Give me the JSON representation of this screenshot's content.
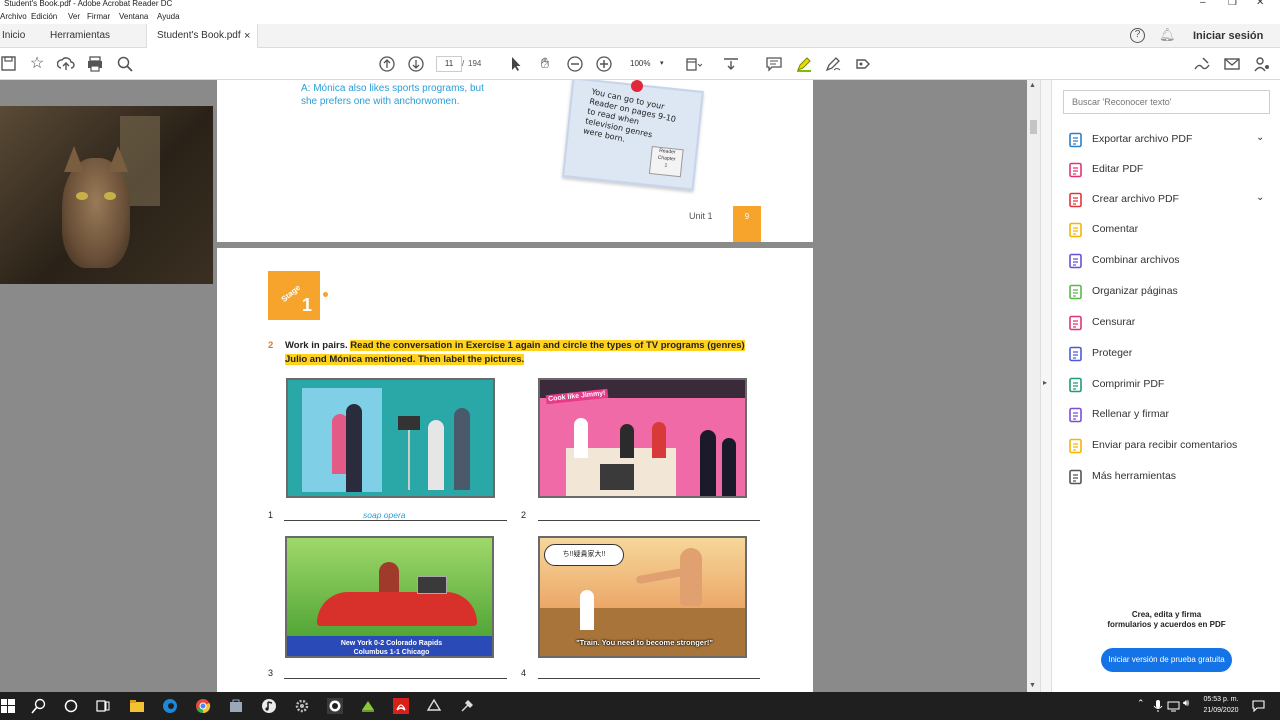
{
  "window": {
    "title": "Student's Book.pdf - Adobe Acrobat Reader DC",
    "menu": [
      "Archivo",
      "Edición",
      "Ver",
      "Firmar",
      "Ventana",
      "Ayuda"
    ]
  },
  "tabs": {
    "home": "Inicio",
    "tools": "Herramientas",
    "document": "Student's Book.pdf",
    "close": "×",
    "signin": "Iniciar sesión"
  },
  "toolbar": {
    "page_current": "11",
    "page_sep": "/",
    "page_total": "194",
    "zoom": "100%"
  },
  "page_top": {
    "answer_line1": "A: Mónica also likes sports programs, but",
    "answer_line2": "she prefers one with anchorwomen.",
    "note_lines": [
      "You can go to your",
      "Reader on pages 9-10",
      "to read when",
      "television genres",
      "were born."
    ],
    "note_booklet": [
      "Reader",
      "Chapter",
      "1"
    ],
    "unit_label": "Unit 1",
    "page_number": "9"
  },
  "page_main": {
    "stage_word": "Stage",
    "stage_number": "1",
    "exercise_number": "2",
    "instruction_bold": "Work in pairs.",
    "instruction_line1": "Read the conversation in Exercise 1 again and circle the types of TV programs (genres)",
    "instruction_line2": "Julio and Mónica mentioned. Then label the pictures.",
    "items": [
      {
        "number": "1",
        "answer": "soap opera"
      },
      {
        "number": "2",
        "answer": ""
      },
      {
        "number": "3",
        "answer": ""
      },
      {
        "number": "4",
        "answer": ""
      }
    ],
    "cooking_sign": "Cook like Jimmy!",
    "news_ticker_line1": "New York 0-2 Colorado Rapids",
    "news_ticker_line2": "Columbus 1-1 Chicago",
    "speech_bubble": "ち!!疑貴家大!!",
    "karate_caption": "\"Train. You need to become stronger!\""
  },
  "right_pane": {
    "search_placeholder": "Buscar 'Reconocer texto'",
    "tools": [
      {
        "label": "Exportar archivo PDF",
        "icon": "export-pdf-icon",
        "color": "#2d7fc9",
        "chevron": "⌄"
      },
      {
        "label": "Editar PDF",
        "icon": "edit-pdf-icon",
        "color": "#e0347a",
        "chevron": ""
      },
      {
        "label": "Crear archivo PDF",
        "icon": "create-pdf-icon",
        "color": "#e0343a",
        "chevron": "⌄"
      },
      {
        "label": "Comentar",
        "icon": "comment-icon",
        "color": "#f2b600",
        "chevron": ""
      },
      {
        "label": "Combinar archivos",
        "icon": "combine-files-icon",
        "color": "#6b4fd8",
        "chevron": ""
      },
      {
        "label": "Organizar páginas",
        "icon": "organize-pages-icon",
        "color": "#5cb84a",
        "chevron": ""
      },
      {
        "label": "Censurar",
        "icon": "redact-icon",
        "color": "#e0347a",
        "chevron": ""
      },
      {
        "label": "Proteger",
        "icon": "protect-icon",
        "color": "#4b5bd8",
        "chevron": ""
      },
      {
        "label": "Comprimir PDF",
        "icon": "compress-pdf-icon",
        "color": "#1f9b7a",
        "chevron": ""
      },
      {
        "label": "Rellenar y firmar",
        "icon": "fill-sign-icon",
        "color": "#7a4fd8",
        "chevron": ""
      },
      {
        "label": "Enviar para recibir comentarios",
        "icon": "send-review-icon",
        "color": "#f2b600",
        "chevron": ""
      },
      {
        "label": "Más herramientas",
        "icon": "more-tools-icon",
        "color": "#555555",
        "chevron": ""
      }
    ],
    "promo_line1": "Crea, edita y firma",
    "promo_line2": "formularios y acuerdos en PDF",
    "trial_button": "Iniciar versión de prueba gratuita"
  },
  "taskbar": {
    "time": "05:53 p. m.",
    "date": "21/09/2020"
  },
  "colors": {
    "accent_blue": "#1473e6",
    "highlight": "#ffd21f",
    "stage_orange": "#f7a42c"
  }
}
